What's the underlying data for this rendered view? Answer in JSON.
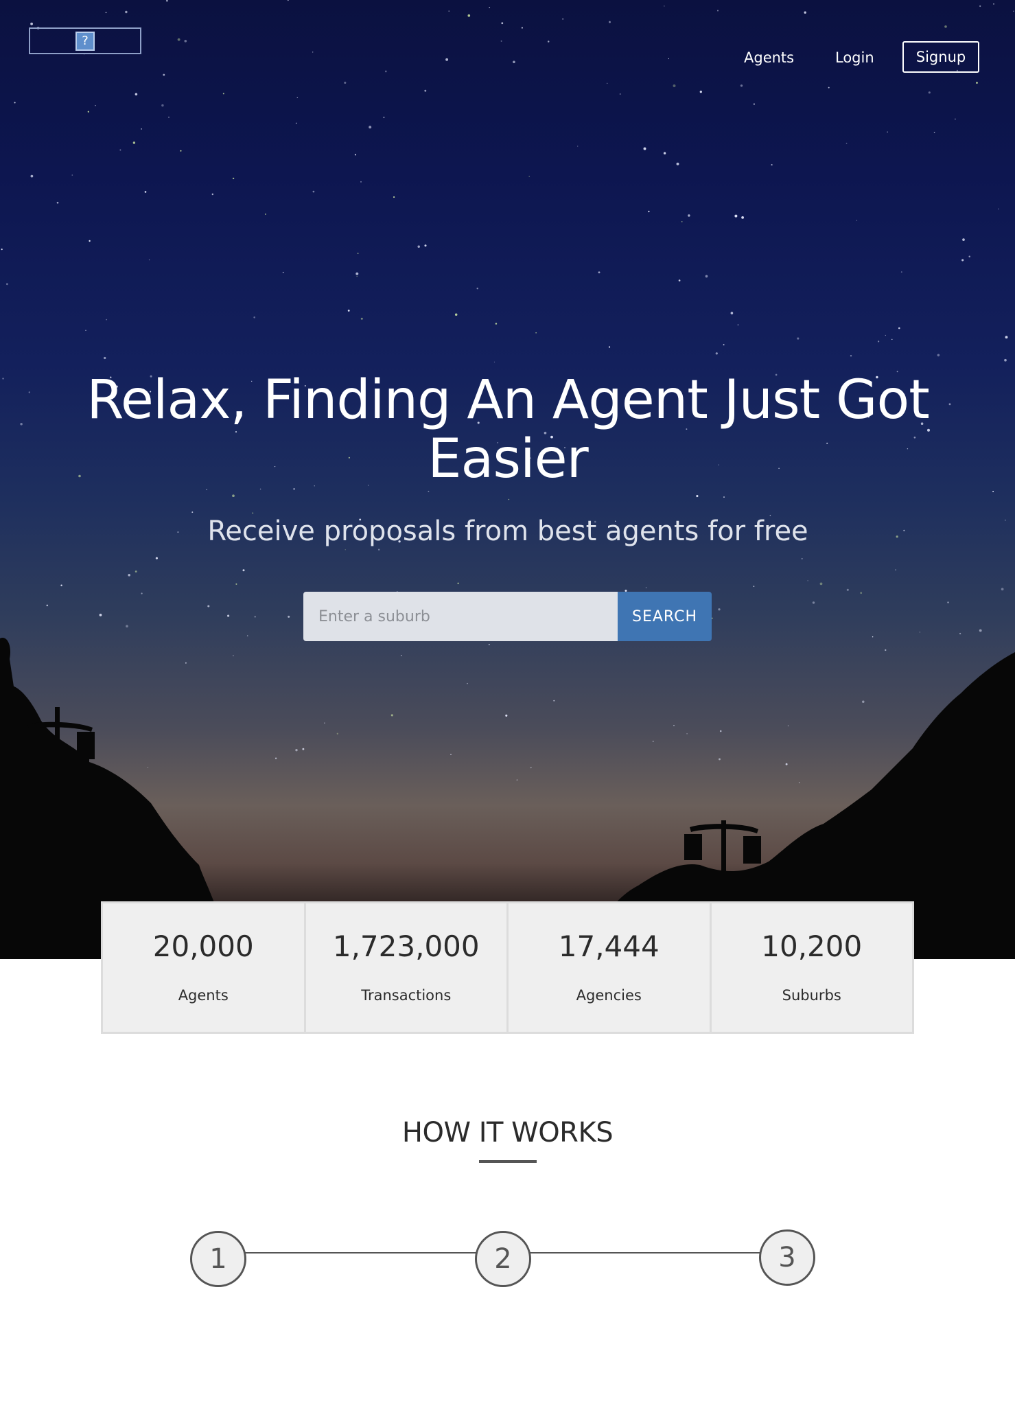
{
  "header": {
    "logo_glyph": "?",
    "nav": {
      "agents": "Agents",
      "login": "Login",
      "signup": "Signup"
    }
  },
  "hero": {
    "headline": "Relax, Finding An Agent Just Got Easier",
    "subheadline": "Receive proposals from best agents for free",
    "search": {
      "placeholder": "Enter a suburb",
      "value": "",
      "button_label": "SEARCH"
    }
  },
  "stats": [
    {
      "value": "20,000",
      "label": "Agents"
    },
    {
      "value": "1,723,000",
      "label": "Transactions"
    },
    {
      "value": "17,444",
      "label": "Agencies"
    },
    {
      "value": "10,200",
      "label": "Suburbs"
    }
  ],
  "how_it_works": {
    "title": "HOW IT WORKS",
    "steps": [
      "1",
      "2",
      "3"
    ]
  },
  "colors": {
    "accent": "#3f75b3",
    "stats_bg": "#efefef",
    "step_stroke": "#555555"
  }
}
